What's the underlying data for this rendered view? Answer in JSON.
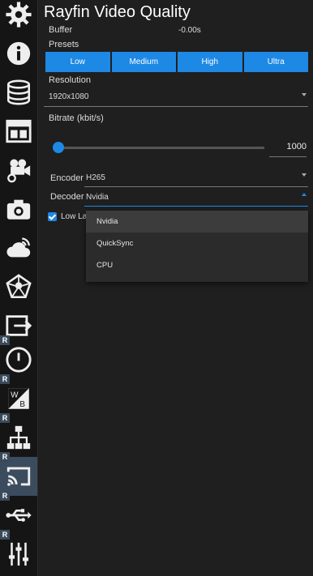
{
  "app": {
    "title": "Rayfin Video Quality"
  },
  "sidebar": {
    "items": [
      {
        "name": "gear-icon",
        "badge": ""
      },
      {
        "name": "info-icon",
        "badge": ""
      },
      {
        "name": "database-icon",
        "badge": ""
      },
      {
        "name": "layout-icon",
        "badge": ""
      },
      {
        "name": "camera-settings-icon",
        "badge": ""
      },
      {
        "name": "camera-icon",
        "badge": ""
      },
      {
        "name": "cloud-icon",
        "badge": ""
      },
      {
        "name": "network-pentagon-icon",
        "badge": ""
      },
      {
        "name": "export-icon",
        "badge": ""
      },
      {
        "name": "clock-icon",
        "badge": "R"
      },
      {
        "name": "white-balance-icon",
        "badge": "R"
      },
      {
        "name": "network-hierarchy-icon",
        "badge": "R"
      },
      {
        "name": "cast-icon",
        "badge": "R"
      },
      {
        "name": "usb-icon",
        "badge": "R"
      },
      {
        "name": "sliders-icon",
        "badge": "R"
      }
    ]
  },
  "buffer": {
    "label": "Buffer",
    "value": "-0.00s"
  },
  "presets": {
    "label": "Presets",
    "options": [
      "Low",
      "Medium",
      "High",
      "Ultra"
    ]
  },
  "resolution": {
    "label": "Resolution",
    "value": "1920x1080"
  },
  "bitrate": {
    "label": "Bitrate (kbit/s)",
    "value": "1000",
    "fraction": 0.0
  },
  "encoder": {
    "label": "Encoder",
    "value": "H265"
  },
  "decoder": {
    "label": "Decoder",
    "value": "Nvidia",
    "options": [
      "Nvidia",
      "QuickSync",
      "CPU"
    ]
  },
  "low_latency": {
    "label": "Low Lat"
  },
  "colors": {
    "accent": "#1e88e5",
    "background": "#1f1f1f",
    "sidebar": "#151515"
  }
}
